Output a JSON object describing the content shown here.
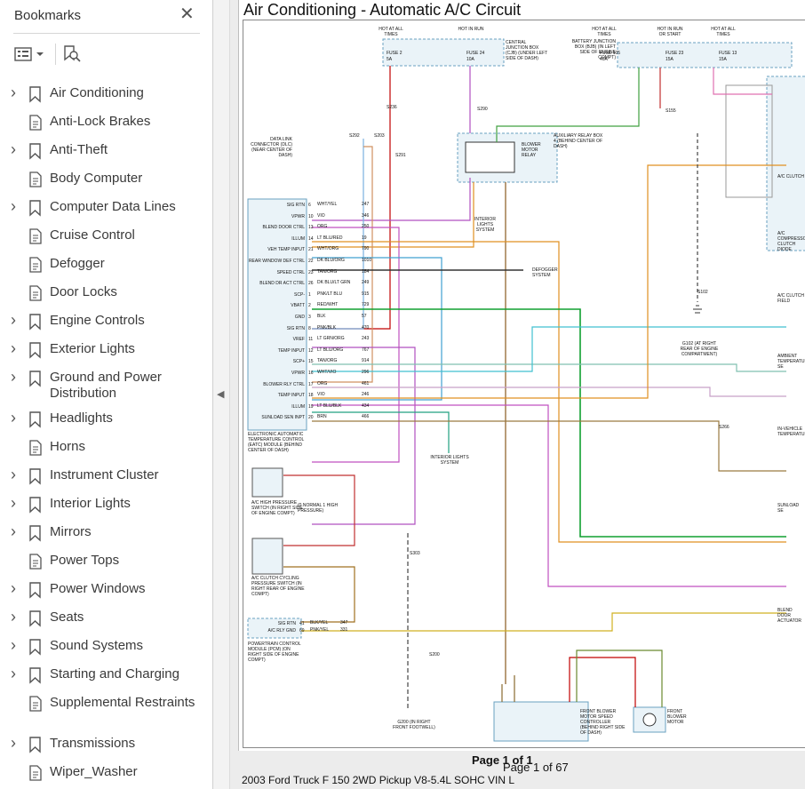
{
  "sidebar": {
    "title": "Bookmarks",
    "items": [
      {
        "label": "Air Conditioning",
        "expandable": true
      },
      {
        "label": "Anti-Lock Brakes",
        "expandable": false
      },
      {
        "label": "Anti-Theft",
        "expandable": true
      },
      {
        "label": "Body Computer",
        "expandable": false
      },
      {
        "label": "Computer Data Lines",
        "expandable": true
      },
      {
        "label": "Cruise Control",
        "expandable": false
      },
      {
        "label": "Defogger",
        "expandable": false
      },
      {
        "label": "Door Locks",
        "expandable": false
      },
      {
        "label": "Engine Controls",
        "expandable": true
      },
      {
        "label": "Exterior Lights",
        "expandable": true
      },
      {
        "label": "Ground and Power Distribution",
        "expandable": true
      },
      {
        "label": "Headlights",
        "expandable": true
      },
      {
        "label": "Horns",
        "expandable": false
      },
      {
        "label": "Instrument Cluster",
        "expandable": true
      },
      {
        "label": "Interior Lights",
        "expandable": true
      },
      {
        "label": "Mirrors",
        "expandable": true
      },
      {
        "label": "Power Tops",
        "expandable": false
      },
      {
        "label": "Power Windows",
        "expandable": true
      },
      {
        "label": "Seats",
        "expandable": true
      },
      {
        "label": "Sound Systems",
        "expandable": true
      },
      {
        "label": "Starting and Charging",
        "expandable": true
      },
      {
        "label": "Supplemental Restraints",
        "expandable": false
      },
      {
        "label": "Transmissions",
        "expandable": true
      },
      {
        "label": "Wiper_Washer",
        "expandable": false
      }
    ]
  },
  "document": {
    "title": "Air Conditioning - Automatic A/C Circuit",
    "page_label": "Page 1 of 1",
    "page_counter": "Page 1 of 67",
    "footer": "2003 Ford Truck F 150 2WD Pickup V8-5.4L SOHC VIN L"
  },
  "diagram": {
    "fuses": [
      {
        "hot": "HOT AT ALL TIMES",
        "fuse": "FUSE 2",
        "amps": "5A"
      },
      {
        "hot": "HOT IN RUN",
        "fuse": "FUSE 24",
        "amps": "10A"
      },
      {
        "hot": "HOT AT ALL TIMES",
        "fuse": "FUSE 105",
        "amps": "40A"
      },
      {
        "hot": "HOT IN RUN OR START",
        "fuse": "FUSE 23",
        "amps": "15A"
      },
      {
        "hot": "HOT AT ALL TIMES",
        "fuse": "FUSE 13",
        "amps": "15A"
      }
    ],
    "cjb_label": "CENTRAL JUNCTION BOX (CJB) (UNDER LEFT SIDE OF DASH)",
    "bjb_label": "BATTERY JUNCTION BOX (BJB) (IN LEFT SIDE OF ENGINE COMPT)",
    "relay_label": "AUXILIARY RELAY BOX 4 (BEHIND CENTER OF DASH)",
    "relay_name": "BLOWER MOTOR RELAY",
    "module_name": "ELECTRONIC AUTOMATIC TEMPERATURE CONTROL (EATC) MODULE (BEHIND CENTER OF DASH)",
    "module_pins": [
      {
        "label": "SIG RTN",
        "pin": "6",
        "wire": "WHT/YEL",
        "circuit": "247"
      },
      {
        "label": "VPWR",
        "pin": "10",
        "wire": "VIO",
        "circuit": "346"
      },
      {
        "label": "BLEND DOOR CTRL",
        "pin": "13",
        "wire": "ORG",
        "circuit": "250"
      },
      {
        "label": "ILLUM",
        "pin": "14",
        "wire": "LT BLU/RED",
        "circuit": "19"
      },
      {
        "label": "VEH TEMP INPUT",
        "pin": "21",
        "wire": "WHT/ORG",
        "circuit": "790"
      },
      {
        "label": "REAR WINDOW DEF CTRL",
        "pin": "22",
        "wire": "DK BLU/ORG",
        "circuit": "1010"
      },
      {
        "label": "SPEED CTRL",
        "pin": "23",
        "wire": "TAN/ORG",
        "circuit": "184"
      },
      {
        "label": "BLEND DR ACT CTRL",
        "pin": "26",
        "wire": "DK BLU/LT GRN",
        "circuit": "249"
      },
      {
        "label": "SCP-",
        "pin": "1",
        "wire": "PNK/LT BLU",
        "circuit": "915"
      },
      {
        "label": "VBATT",
        "pin": "2",
        "wire": "RED/WHT",
        "circuit": "729"
      },
      {
        "label": "GND",
        "pin": "3",
        "wire": "BLK",
        "circuit": "57"
      },
      {
        "label": "SIG RTN",
        "pin": "8",
        "wire": "PNK/BLK",
        "circuit": "470"
      },
      {
        "label": "VREF",
        "pin": "11",
        "wire": "LT GRN/ORG",
        "circuit": "243"
      },
      {
        "label": "TEMP INPUT",
        "pin": "12",
        "wire": "LT BLU/ORG",
        "circuit": "767"
      },
      {
        "label": "SCP+",
        "pin": "15",
        "wire": "TAN/ORG",
        "circuit": "914"
      },
      {
        "label": "VPWR",
        "pin": "16",
        "wire": "WHT/VIO",
        "circuit": "296"
      },
      {
        "label": "BLOWER RLY CTRL",
        "pin": "17",
        "wire": "ORG",
        "circuit": "461"
      },
      {
        "label": "TEMP INPUT",
        "pin": "18",
        "wire": "VIO",
        "circuit": "246"
      },
      {
        "label": "ILLUM",
        "pin": "19",
        "wire": "LT BLU/BLK",
        "circuit": "434"
      },
      {
        "label": "SUNLOAD SEN INPT",
        "pin": "20",
        "wire": "BRN",
        "circuit": "466"
      }
    ],
    "switch_hp": "A/C HIGH PRESSURE SWITCH (IN RIGHT SIDE OF ENGINE COMPT)",
    "switch_hp_legend": "(0 NORMAL 1 HIGH PRESSURE)",
    "switch_cc": "A/C CLUTCH CYCLING PRESSURE SWITCH (IN RIGHT REAR OF ENGINE COMPT)",
    "pcm": "POWERTRAIN CONTROL MODULE (PCM) (ON RIGHT SIDE OF ENGINE COMPT)",
    "pcm_pins": [
      {
        "label": "SIG RTN",
        "pin": "41",
        "wire": "BLK/YEL",
        "circuit": "347"
      },
      {
        "label": "A/C RLY GND",
        "pin": "69",
        "wire": "PNK/YEL",
        "circuit": "331"
      }
    ],
    "splices": [
      "S203",
      "S292",
      "S291",
      "S290",
      "S236",
      "S155",
      "S102",
      "S266",
      "S303",
      "S200"
    ],
    "grounds": [
      "G102 (AT RIGHT REAR OF ENGINE COMPARTMENT)",
      "G200 (IN RIGHT FRONT FOOTWELL)"
    ],
    "defogger": "DEFOGGER SYSTEM",
    "interior_lights": "INTERIOR LIGHTS SYSTEM",
    "dlc": "DATA LINK CONNECTOR (DLC) (NEAR CENTER OF DASH)",
    "blower_ctrl": "FRONT BLOWER MOTOR SPEED CONTROLLER (BEHIND RIGHT SIDE OF DASH)",
    "blower_motor": "FRONT BLOWER MOTOR",
    "right_labels": [
      "A/C CLUTCH",
      "A/C COMPRESSOR CLUTCH DIODE",
      "A/C CLUTCH FIELD",
      "AMBIENT TEMPERATURE SE",
      "IN-VEHICLE TEMPERATURE",
      "SUNLOAD SE",
      "BLEND DOOR ACTUATOR"
    ]
  }
}
